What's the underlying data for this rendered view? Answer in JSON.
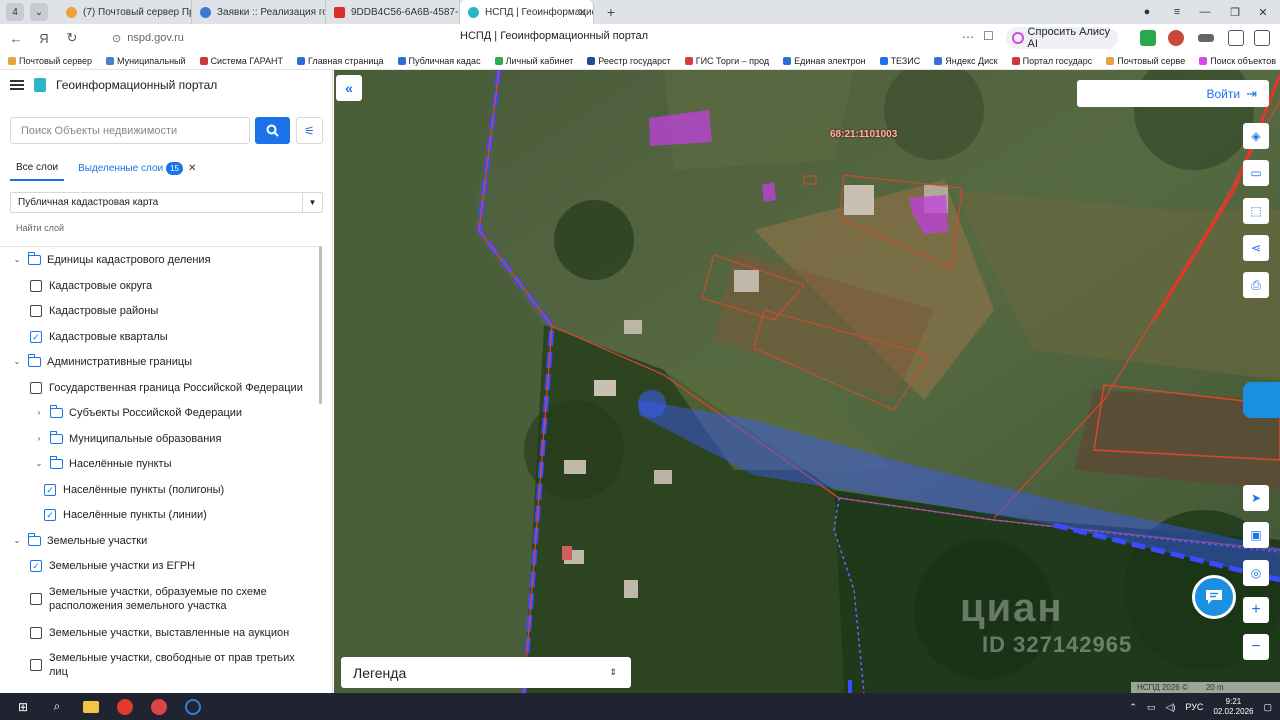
{
  "browser": {
    "tab_count": "4",
    "tabs": [
      {
        "label": "(7) Почтовый сервер Пра",
        "color": "#e8a33c"
      },
      {
        "label": "Заявки :: Реализация госу",
        "color": "#3a7bd5"
      },
      {
        "label": "9DDB4C56-6A6B-4587-B2",
        "color": "#d93025"
      },
      {
        "label": "НСПД | Геоинформацио",
        "color": "#2bb5c8"
      }
    ],
    "url": "nspd.gov.ru",
    "page_title": "НСПД | Геоинформационный портал",
    "alisa_label": "Спросить Алису AI",
    "bookmarks": [
      "Почтовый сервер",
      "Муниципальный",
      "Система ГАРАНТ",
      "Главная страница",
      "Публичная кадас",
      "Личный кабинет",
      "Реестр государст",
      "ГИС Торги – прод",
      "Единая электрон",
      "ТЕЗИС",
      "Яндекс Диск",
      "Портал государс",
      "Почтовый серве",
      "Поиск объектов"
    ]
  },
  "sidebar": {
    "app_title": "Геоинформационный портал",
    "search_placeholder": "Поиск Объекты недвижимости",
    "tab_all": "Все слои",
    "tab_selected": "Выделенные слои",
    "selected_count": "15",
    "select_value": "Публичная кадастровая карта",
    "find_layer": "Найти слой",
    "tree": [
      {
        "label": "Единицы кадастрового деления",
        "type": "group"
      },
      {
        "label": "Кадастровые округа",
        "type": "check",
        "checked": false
      },
      {
        "label": "Кадастровые районы",
        "type": "check",
        "checked": false
      },
      {
        "label": "Кадастровые кварталы",
        "type": "check",
        "checked": true
      },
      {
        "label": "Административные границы",
        "type": "group"
      },
      {
        "label": "Государственная граница Российской Федерации",
        "type": "check",
        "checked": false
      },
      {
        "label": "Субъекты Российской Федерации",
        "type": "subgroup"
      },
      {
        "label": "Муниципальные образования",
        "type": "subgroup"
      },
      {
        "label": "Населённые пункты",
        "type": "subgroup-open"
      },
      {
        "label": "Населённые пункты (полигоны)",
        "type": "check",
        "checked": true
      },
      {
        "label": "Населённые пункты (линии)",
        "type": "check",
        "checked": true
      },
      {
        "label": "Земельные участки",
        "type": "group"
      },
      {
        "label": "Земельные участки из ЕГРН",
        "type": "check",
        "checked": true
      },
      {
        "label": "Земельные участки, образуемые по схеме расположения земельного участка",
        "type": "check",
        "checked": false
      },
      {
        "label": "Земельные участки, выставленные на аукцион",
        "type": "check",
        "checked": false
      },
      {
        "label": "Земельные участки, свободные от прав третьих лиц",
        "type": "check",
        "checked": false
      }
    ]
  },
  "map": {
    "login_label": "Войти",
    "cadastral_label": "68:21:1101003",
    "legend_label": "Легенда",
    "watermark": "циан",
    "watermark_id": "ID 327142965",
    "scale_copyright": "НСПД 2026 ©",
    "scale_value": "20 m"
  },
  "taskbar": {
    "lang": "РУС",
    "time": "9:21",
    "date": "02.02.2026"
  },
  "colors": {
    "accent": "#1a73e8",
    "parcel_border": "#e0452b",
    "highlight_purple": "#c040e0"
  }
}
